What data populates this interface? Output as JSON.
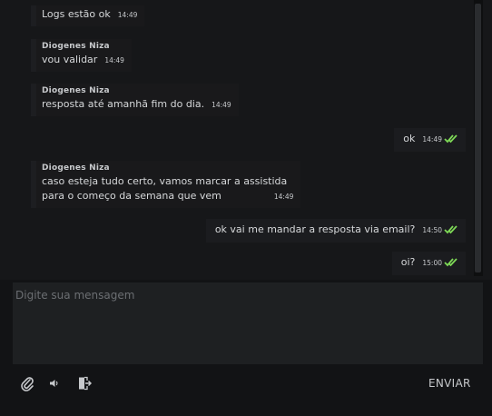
{
  "messages": [
    {
      "direction": "in",
      "sender": "",
      "lines": [
        "Logs estão ok"
      ],
      "time": "14:49"
    },
    {
      "direction": "in",
      "sender": "Diogenes Niza",
      "lines": [
        "vou validar"
      ],
      "time": "14:49"
    },
    {
      "direction": "in",
      "sender": "Diogenes Niza",
      "lines": [
        "resposta até amanhã fim do dia."
      ],
      "time": "14:49"
    },
    {
      "direction": "out",
      "lines": [
        "ok"
      ],
      "time": "14:49",
      "status_icon": "double-check-icon"
    },
    {
      "direction": "in",
      "sender": "Diogenes Niza",
      "lines": [
        "caso esteja tudo certo, vamos marcar a assistida",
        "para o começo da semana que vem"
      ],
      "time": "14:49"
    },
    {
      "direction": "out",
      "lines": [
        "ok vai me mandar a resposta via email?"
      ],
      "time": "14:50",
      "status_icon": "double-check-icon"
    },
    {
      "direction": "out",
      "lines": [
        "oi?"
      ],
      "time": "15:00",
      "status_icon": "double-check-icon"
    }
  ],
  "composer": {
    "placeholder": "Digite sua mensagem"
  },
  "toolbar": {
    "attach_icon": "paperclip-icon",
    "audio_icon": "speaker-icon",
    "exit_icon": "exit-door-icon",
    "send_label": "ENVIAR"
  },
  "colors": {
    "read_check": "#7ed957",
    "background": "#121315",
    "input_bg": "#1e2022"
  }
}
